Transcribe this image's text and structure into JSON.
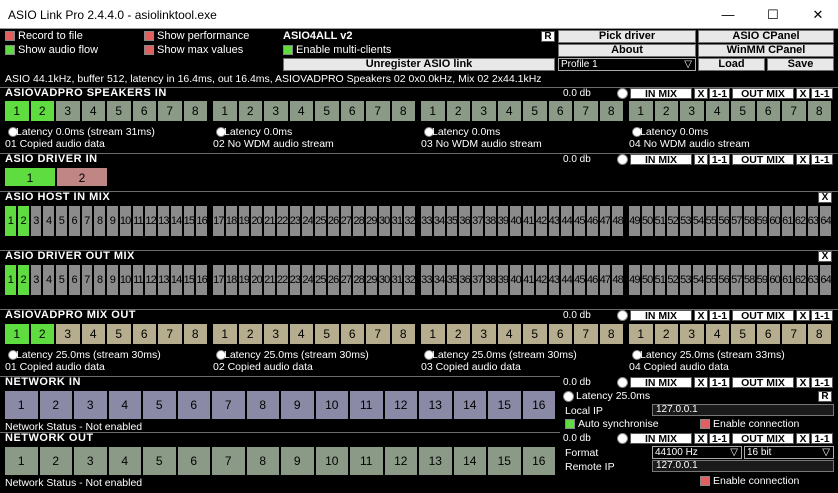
{
  "window": {
    "title": "ASIO Link Pro 2.4.4.0 - asiolinktool.exe",
    "minimize": "—",
    "maximize": "☐",
    "close": "✕"
  },
  "options": {
    "record_to_file": "Record to file",
    "show_audio_flow": "Show audio flow",
    "show_performance": "Show performance",
    "show_max_values": "Show max values",
    "driver_name": "ASIO4ALL v2",
    "driver_badge": "R",
    "enable_multi_clients": "Enable multi-clients",
    "unregister": "Unregister ASIO link"
  },
  "buttons": {
    "pick_driver": "Pick driver",
    "asio_cpanel": "ASIO CPanel",
    "about": "About",
    "winmm_cpanel": "WinMM CPanel",
    "load": "Load",
    "save": "Save"
  },
  "profile": {
    "value": "Profile 1",
    "arrow": "▽"
  },
  "status_line": "ASIO 44.1kHz, buffer 512, latency in 16.4ms, out 16.4ms, ASIOVADPRO Speakers 02 0x0.0kHz, Mix 02 2x44.1kHz",
  "mix_labels": {
    "in_mix": "IN MIX",
    "out_mix": "OUT MIX",
    "x": "X",
    "one_one": "1-1"
  },
  "sections": {
    "speakers_in": {
      "title": "ASIOVADPRO SPEAKERS IN",
      "db": "0.0 db",
      "channels": [
        "1",
        "2",
        "3",
        "4",
        "5",
        "6",
        "7",
        "8"
      ],
      "groups": [
        {
          "latency": "Latency 0.0ms (stream 31ms)",
          "stream": "01 Copied audio data"
        },
        {
          "latency": "Latency 0.0ms",
          "stream": "02 No WDM audio stream"
        },
        {
          "latency": "Latency 0.0ms",
          "stream": "03 No WDM audio stream"
        },
        {
          "latency": "Latency 0.0ms",
          "stream": "04 No WDM audio stream"
        }
      ]
    },
    "driver_in": {
      "title": "ASIO DRIVER IN",
      "db": "0.0 db",
      "channels": [
        "1",
        "2"
      ]
    },
    "host_in_mix": {
      "title": "ASIO HOST IN MIX",
      "x": "X"
    },
    "driver_out_mix": {
      "title": "ASIO DRIVER OUT MIX",
      "x": "X"
    },
    "mix_out": {
      "title": "ASIOVADPRO MIX OUT",
      "db": "0.0 db",
      "channels": [
        "1",
        "2",
        "3",
        "4",
        "5",
        "6",
        "7",
        "8"
      ],
      "groups": [
        {
          "latency": "Latency 25.0ms (stream 30ms)",
          "stream": "01 Copied audio data"
        },
        {
          "latency": "Latency 25.0ms (stream 30ms)",
          "stream": "02 Copied audio data"
        },
        {
          "latency": "Latency 25.0ms (stream 30ms)",
          "stream": "03 Copied audio data"
        },
        {
          "latency": "Latency 25.0ms (stream 33ms)",
          "stream": "04 Copied audio data"
        }
      ]
    },
    "network_in": {
      "title": "NETWORK IN",
      "db": "0.0 db",
      "channels": [
        "1",
        "2",
        "3",
        "4",
        "5",
        "6",
        "7",
        "8",
        "9",
        "10",
        "11",
        "12",
        "13",
        "14",
        "15",
        "16"
      ],
      "status": "Network Status - Not enabled",
      "latency": "Latency 25.0ms",
      "badge": "R",
      "local_ip_label": "Local IP",
      "local_ip": "127.0.0.1",
      "auto_sync": "Auto synchronise",
      "enable_connection": "Enable connection"
    },
    "network_out": {
      "title": "NETWORK OUT",
      "db": "0.0 db",
      "channels": [
        "1",
        "2",
        "3",
        "4",
        "5",
        "6",
        "7",
        "8",
        "9",
        "10",
        "11",
        "12",
        "13",
        "14",
        "15",
        "16"
      ],
      "status": "Network Status - Not enabled",
      "format_label": "Format",
      "format_rate": "44100 Hz",
      "format_bits": "16 bit",
      "remote_ip_label": "Remote IP",
      "remote_ip": "127.0.0.1",
      "enable_connection": "Enable connection"
    }
  },
  "colors": {
    "check_red": "#e06060",
    "check_green": "#5fdc40",
    "cell_green": "#8a9a86",
    "cell_tan": "#b5ad8e",
    "cell_gray": "#8b8b8b",
    "cell_blue": "#8a8aa6",
    "active_green": "#5fdc40"
  }
}
